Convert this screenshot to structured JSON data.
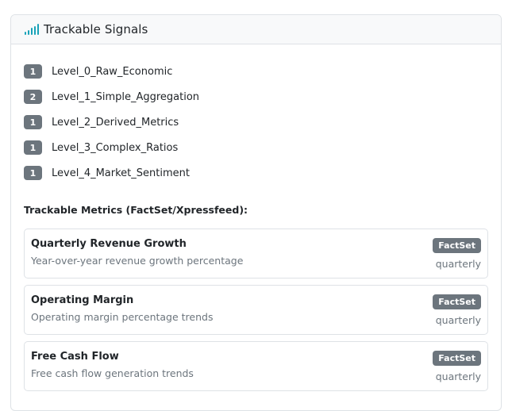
{
  "header": {
    "icon": "signal-bars-icon",
    "title": "Trackable Signals",
    "accent_color": "#17a2b8"
  },
  "levels": [
    {
      "count": "1",
      "label": "Level_0_Raw_Economic"
    },
    {
      "count": "2",
      "label": "Level_1_Simple_Aggregation"
    },
    {
      "count": "1",
      "label": "Level_2_Derived_Metrics"
    },
    {
      "count": "1",
      "label": "Level_3_Complex_Ratios"
    },
    {
      "count": "1",
      "label": "Level_4_Market_Sentiment"
    }
  ],
  "metrics_section": {
    "heading": "Trackable Metrics (FactSet/Xpressfeed):",
    "items": [
      {
        "name": "Quarterly Revenue Growth",
        "description": "Year-over-year revenue growth percentage",
        "source": "FactSet",
        "frequency": "quarterly"
      },
      {
        "name": "Operating Margin",
        "description": "Operating margin percentage trends",
        "source": "FactSet",
        "frequency": "quarterly"
      },
      {
        "name": "Free Cash Flow",
        "description": "Free cash flow generation trends",
        "source": "FactSet",
        "frequency": "quarterly"
      }
    ]
  }
}
